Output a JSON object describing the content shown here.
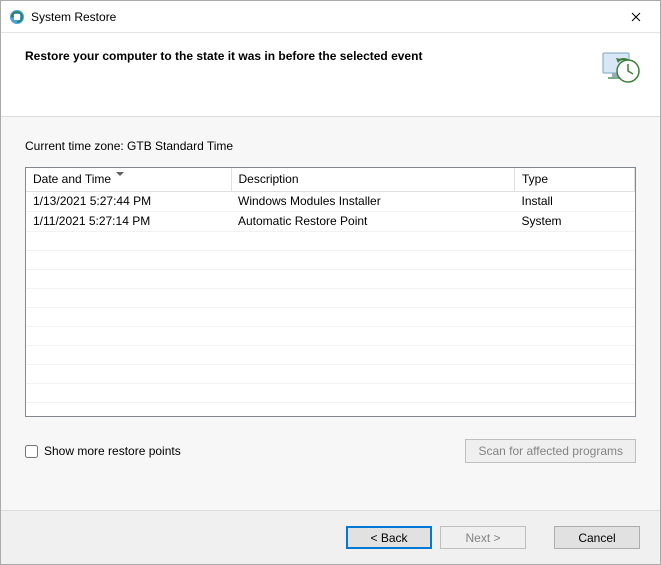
{
  "titlebar": {
    "title": "System Restore"
  },
  "header": {
    "heading": "Restore your computer to the state it was in before the selected event"
  },
  "body": {
    "timezone_label": "Current time zone: GTB Standard Time",
    "columns": {
      "date": "Date and Time",
      "desc": "Description",
      "type": "Type"
    },
    "rows": [
      {
        "date": "1/13/2021 5:27:44 PM",
        "desc": "Windows Modules Installer",
        "type": "Install"
      },
      {
        "date": "1/11/2021 5:27:14 PM",
        "desc": "Automatic Restore Point",
        "type": "System"
      }
    ],
    "show_more_label": "Show more restore points",
    "scan_button": "Scan for affected programs"
  },
  "footer": {
    "back": "< Back",
    "next": "Next >",
    "cancel": "Cancel"
  }
}
